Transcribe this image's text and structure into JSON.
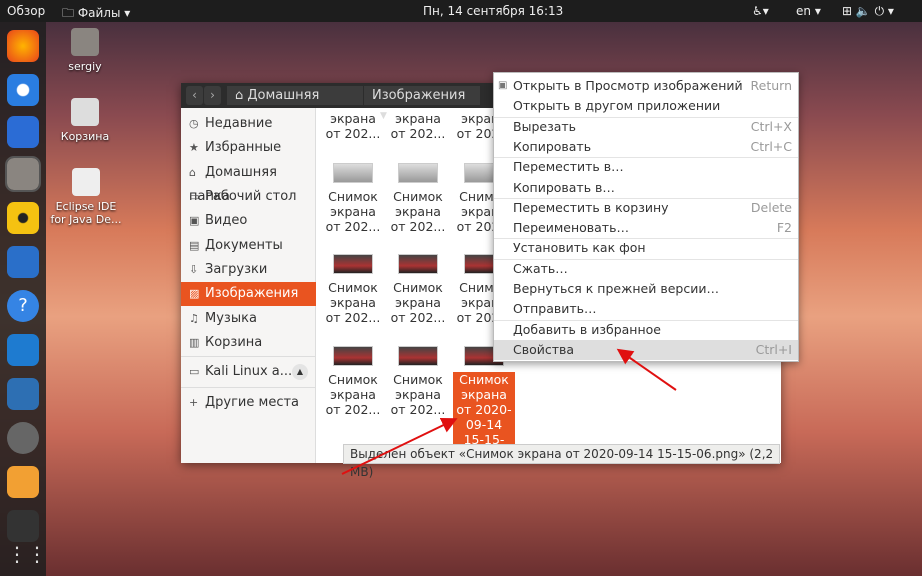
{
  "topbar": {
    "activities": "Обзор",
    "app_menu": "Файлы",
    "clock": "Пн, 14 сентября  16:13",
    "lang": "en"
  },
  "desktop": [
    {
      "label": "sergiy"
    },
    {
      "label": "Корзина"
    },
    {
      "label": "Eclipse IDE for Java De..."
    }
  ],
  "dock": [
    "firefox",
    "chromium",
    "thunderbird",
    "files",
    "rhythmbox",
    "libreoffice-writer",
    "help",
    "vscode",
    "system-monitor",
    "settings",
    "eclipse",
    "terminal",
    "apps-grid"
  ],
  "breadcrumb": [
    "Домашняя папка",
    "Изображения"
  ],
  "sidebar": [
    {
      "label": "Недавние",
      "icon": "clock"
    },
    {
      "label": "Избранные",
      "icon": "star"
    },
    {
      "label": "Домашняя папка",
      "icon": "home"
    },
    {
      "label": "Рабочий стол",
      "icon": "desktop"
    },
    {
      "label": "Видео",
      "icon": "video"
    },
    {
      "label": "Документы",
      "icon": "document"
    },
    {
      "label": "Загрузки",
      "icon": "download"
    },
    {
      "label": "Изображения",
      "icon": "image",
      "selected": true
    },
    {
      "label": "Музыка",
      "icon": "music"
    },
    {
      "label": "Корзина",
      "icon": "trash"
    },
    {
      "label": "Kali Linux a...",
      "icon": "drive"
    },
    {
      "label": "Другие места",
      "icon": "plus"
    }
  ],
  "files": {
    "name_l1": "Снимок",
    "name_l2": "экрана",
    "name_l3": "от 202...",
    "selected": [
      "Снимок",
      "экрана",
      "от 2020-",
      "09-14",
      "15-15-"
    ]
  },
  "status": "Выделен объект «Снимок экрана от 2020-09-14 15-15-06.png» (2,2 MB)",
  "menu": [
    {
      "label": "Открыть в Просмотр изображений",
      "key": "Return"
    },
    {
      "label": "Открыть в другом приложении",
      "key": ""
    },
    {
      "label": "Вырезать",
      "key": "Ctrl+X"
    },
    {
      "label": "Копировать",
      "key": "Ctrl+C"
    },
    {
      "label": "Переместить в…",
      "key": ""
    },
    {
      "label": "Копировать в…",
      "key": ""
    },
    {
      "label": "Переместить в корзину",
      "key": "Delete"
    },
    {
      "label": "Переименовать…",
      "key": "F2"
    },
    {
      "label": "Установить как фон",
      "key": ""
    },
    {
      "label": "Сжать…",
      "key": ""
    },
    {
      "label": "Вернуться к прежней версии…",
      "key": ""
    },
    {
      "label": "Отправить…",
      "key": ""
    },
    {
      "label": "Добавить в избранное",
      "key": ""
    },
    {
      "label": "Свойства",
      "key": "Ctrl+I"
    }
  ],
  "colors": {
    "accent": "#e95420",
    "arrow": "#e01010"
  }
}
